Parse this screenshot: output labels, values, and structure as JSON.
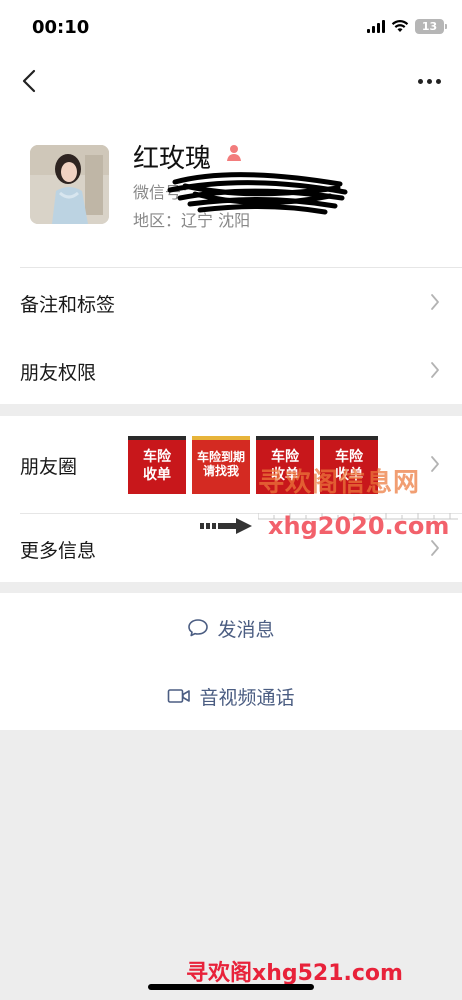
{
  "status_bar": {
    "time": "00:10",
    "battery": "13"
  },
  "nav": {
    "back_icon": "chevron-left-icon",
    "more_icon": "more-dots-icon"
  },
  "profile": {
    "nickname": "红玫瑰",
    "wechat_id_label": "微信号：",
    "region": "地区：辽宁 沈阳",
    "gender_icon_color": "#f27c7c"
  },
  "menu": {
    "remarks_tags": "备注和标签",
    "friend_permissions": "朋友权限",
    "moments": "朋友圈",
    "more_info": "更多信息"
  },
  "moments_thumbs": [
    {
      "line1": "车险",
      "line2": "收单"
    },
    {
      "line1": "车险到期",
      "line2": "请找我"
    },
    {
      "line1": "车险",
      "line2": "收单"
    },
    {
      "line1": "车险",
      "line2": "收单"
    }
  ],
  "actions": {
    "send_message": "发消息",
    "video_call": "音视频通话"
  },
  "watermarks": {
    "top": "寻欢阁信息网",
    "url": "xhg2020.com",
    "bottom": "寻欢阁xhg521.com"
  },
  "colors": {
    "accent_link": "#4b5d82",
    "background": "#ededed"
  }
}
